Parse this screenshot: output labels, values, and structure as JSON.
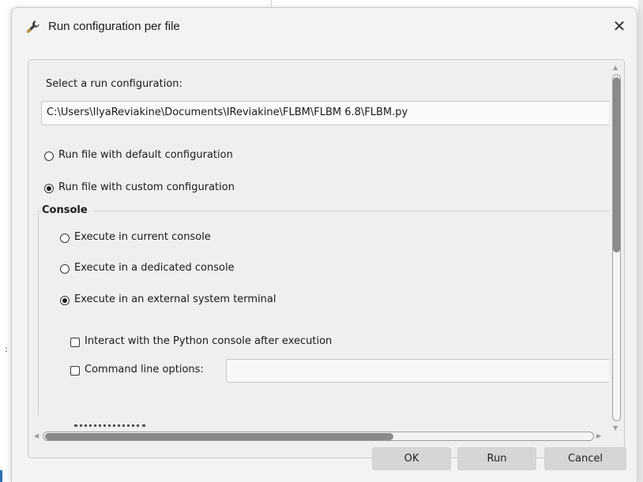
{
  "dialog": {
    "title": "Run configuration per file",
    "close_glyph": "✕",
    "icon": "wrench-icon"
  },
  "content": {
    "select_label": "Select a run configuration:",
    "file_path": "C:\\Users\\IlyaReviakine\\Documents\\IReviakine\\FLBM\\FLBM 6.8\\FLBM.py",
    "radio_default": {
      "label": "Run file with default configuration",
      "checked": false
    },
    "radio_custom": {
      "label": "Run file with custom configuration",
      "checked": true
    },
    "console_group": {
      "title": "Console",
      "options": [
        {
          "label": "Execute in current console",
          "checked": false
        },
        {
          "label": "Execute in a dedicated console",
          "checked": false
        },
        {
          "label": "Execute in an external system terminal",
          "checked": true
        }
      ],
      "interact_label": "Interact with the Python console after execution",
      "interact_checked": false,
      "cmd_options_label": "Command line options:",
      "cmd_options_checked": false,
      "cmd_options_value": ""
    }
  },
  "scrollbars": {
    "vertical_position": 0.0,
    "horizontal_position": 0.0
  },
  "buttons": {
    "ok": "OK",
    "run": "Run",
    "cancel": "Cancel"
  },
  "colors": {
    "dialog_bg": "#f3f3f3",
    "button_bg": "#d6d6d6"
  }
}
